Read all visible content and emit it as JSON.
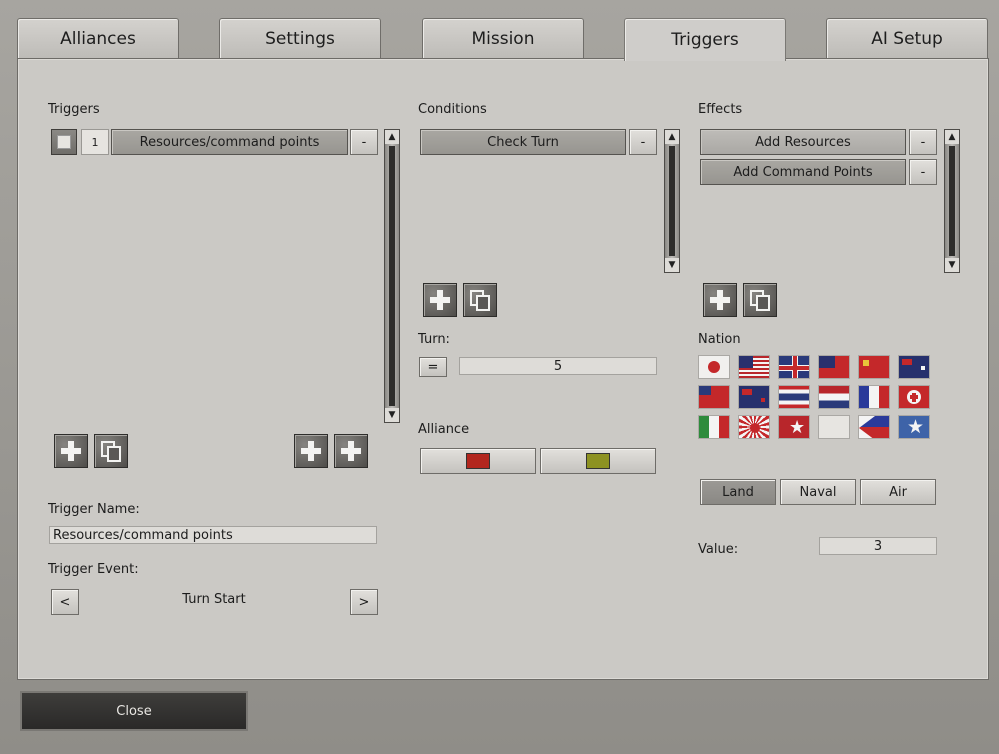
{
  "tabs": [
    "Alliances",
    "Settings",
    "Mission",
    "Triggers",
    "AI Setup"
  ],
  "triggers": {
    "label": "Triggers",
    "items": [
      {
        "number": "1",
        "name": "Resources/command points",
        "remove": "-"
      }
    ]
  },
  "trigger_name": {
    "label": "Trigger Name:",
    "value": "Resources/command points"
  },
  "trigger_event": {
    "label": "Trigger Event:",
    "value": "Turn Start",
    "prev": "<",
    "next": ">"
  },
  "conditions": {
    "label": "Conditions",
    "items": [
      {
        "name": "Check Turn",
        "remove": "-"
      }
    ]
  },
  "turn": {
    "label": "Turn:",
    "operator": "=",
    "value": "5"
  },
  "alliance": {
    "label": "Alliance",
    "colors": [
      "#b2261e",
      "#8d9222"
    ]
  },
  "effects": {
    "label": "Effects",
    "items": [
      {
        "name": "Add Resources",
        "remove": "-"
      },
      {
        "name": "Add Command Points",
        "remove": "-"
      }
    ]
  },
  "nation": {
    "label": "Nation"
  },
  "unit_types": {
    "land": "Land",
    "naval": "Naval",
    "air": "Air"
  },
  "value": {
    "label": "Value:",
    "value": "3"
  },
  "close_label": "Close"
}
